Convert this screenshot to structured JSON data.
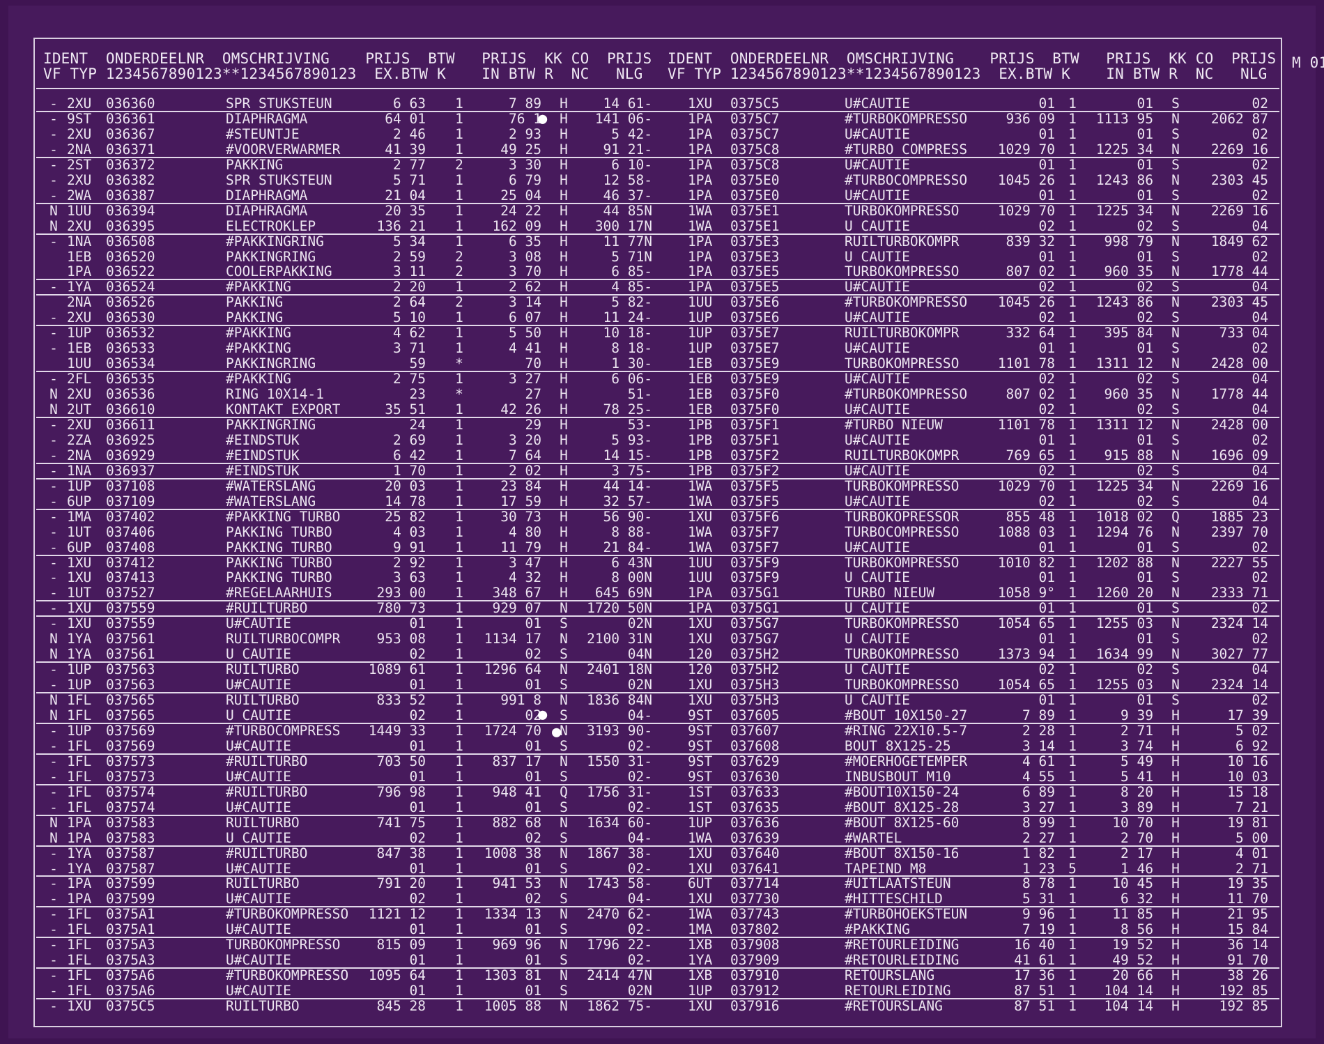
{
  "page_code": "M 01",
  "header": {
    "line1": "IDENT  ONDERDEELNR  OMSCHRIJVING    PRIJS  BTW   PRIJS  KK CO  PRIJS",
    "line2": "VF TYP 1234567890123**1234567890123  EX.BTW K    IN BTW R  NC   NLG"
  },
  "left_rows": [
    [
      "-",
      "2XU",
      "036360",
      "SPR STUKSTEUN",
      "6 63",
      "1",
      "7 89",
      "H",
      "14 61-"
    ],
    [
      "-",
      "9ST",
      "036361",
      "DIAPHRAGMA",
      "64 01",
      "1",
      "76 1",
      "H",
      "141 06-"
    ],
    [
      "-",
      "2XU",
      "036367",
      "#STEUNTJE",
      "2 46",
      "1",
      "2 93",
      "H",
      "5 42-"
    ],
    [
      "-",
      "2NA",
      "036371",
      "#VOORVERWARMER",
      "41 39",
      "1",
      "49 25",
      "H",
      "91 21-"
    ],
    [
      "-",
      "2ST",
      "036372",
      "PAKKING",
      "2 77",
      "2",
      "3 30",
      "H",
      "6 10-"
    ],
    [
      "-",
      "2XU",
      "036382",
      "SPR STUKSTEUN",
      "5 71",
      "1",
      "6 79",
      "H",
      "12 58-"
    ],
    [
      "-",
      "2WA",
      "036387",
      "DIAPHRAGMA",
      "21 04",
      "1",
      "25 04",
      "H",
      "46 37-"
    ],
    [
      "N",
      "1UU",
      "036394",
      "DIAPHRAGMA",
      "20 35",
      "1",
      "24 22",
      "H",
      "44 85N"
    ],
    [
      "N",
      "2XU",
      "036395",
      "ELECTROKLEP",
      "136 21",
      "1",
      "162 09",
      "H",
      "300 17N"
    ],
    [
      "-",
      "1NA",
      "036508",
      "#PAKKINGRING",
      "5 34",
      "1",
      "6 35",
      "H",
      "11 77N"
    ],
    [
      "",
      "1EB",
      "036520",
      "PAKKINGRING",
      "2 59",
      "2",
      "3 08",
      "H",
      "5 71N"
    ],
    [
      "",
      "1PA",
      "036522",
      "COOLERPAKKING",
      "3 11",
      "2",
      "3 70",
      "H",
      "6 85-"
    ],
    [
      "-",
      "1YA",
      "036524",
      "#PAKKING",
      "2 20",
      "1",
      "2 62",
      "H",
      "4 85-"
    ],
    [
      "",
      "2NA",
      "036526",
      "PAKKING",
      "2 64",
      "2",
      "3 14",
      "H",
      "5 82-"
    ],
    [
      "-",
      "2XU",
      "036530",
      "PAKKING",
      "5 10",
      "1",
      "6 07",
      "H",
      "11 24-"
    ],
    [
      "-",
      "1UP",
      "036532",
      "#PAKKING",
      "4 62",
      "1",
      "5 50",
      "H",
      "10 18-"
    ],
    [
      "-",
      "1EB",
      "036533",
      "#PAKKING",
      "3 71",
      "1",
      "4 41",
      "H",
      "8 18-"
    ],
    [
      "",
      "1UU",
      "036534",
      "PAKKINGRING",
      "59",
      "*",
      "70",
      "H",
      "1 30-"
    ],
    [
      "-",
      "2FL",
      "036535",
      "#PAKKING",
      "2 75",
      "1",
      "3 27",
      "H",
      "6 06-"
    ],
    [
      "N",
      "2XU",
      "036536",
      "RING 10X14-1",
      "23",
      "*",
      "27",
      "H",
      "51-"
    ],
    [
      "N",
      "2UT",
      "036610",
      "KONTAKT EXPORT",
      "35 51",
      "1",
      "42 26",
      "H",
      "78 25-"
    ],
    [
      "-",
      "2XU",
      "036611",
      "PAKKINGRING",
      "24",
      "1",
      "29",
      "H",
      "53-"
    ],
    [
      "-",
      "2ZA",
      "036925",
      "#EINDSTUK",
      "2 69",
      "1",
      "3 20",
      "H",
      "5 93-"
    ],
    [
      "-",
      "2NA",
      "036929",
      "#EINDSTUK",
      "6 42",
      "1",
      "7 64",
      "H",
      "14 15-"
    ],
    [
      "-",
      "1NA",
      "036937",
      "#EINDSTUK",
      "1 70",
      "1",
      "2 02",
      "H",
      "3 75-"
    ],
    [
      "-",
      "1UP",
      "037108",
      "#WATERSLANG",
      "20 03",
      "1",
      "23 84",
      "H",
      "44 14-"
    ],
    [
      "-",
      "6UP",
      "037109",
      "#WATERSLANG",
      "14 78",
      "1",
      "17 59",
      "H",
      "32 57-"
    ],
    [
      "-",
      "1MA",
      "037402",
      "#PAKKING TURBO",
      "25 82",
      "1",
      "30 73",
      "H",
      "56 90-"
    ],
    [
      "-",
      "1UT",
      "037406",
      "PAKKING TURBO",
      "4 03",
      "1",
      "4 80",
      "H",
      "8 88-"
    ],
    [
      "-",
      "6UP",
      "037408",
      "PAKKING TURBO",
      "9 91",
      "1",
      "11 79",
      "H",
      "21 84-"
    ],
    [
      "-",
      "1XU",
      "037412",
      "PAKKING TURBO",
      "2 92",
      "1",
      "3 47",
      "H",
      "6 43N"
    ],
    [
      "-",
      "1XU",
      "037413",
      "PAKKING TURBO",
      "3 63",
      "1",
      "4 32",
      "H",
      "8 00N"
    ],
    [
      "-",
      "1UT",
      "037527",
      "#REGELAARHUIS",
      "293 00",
      "1",
      "348 67",
      "H",
      "645 69N"
    ],
    [
      "-",
      "1XU",
      "037559",
      "#RUILTURBO",
      "780 73",
      "1",
      "929 07",
      "N",
      "1720 50N"
    ],
    [
      "-",
      "1XU",
      "037559",
      "U#CAUTIE",
      "01",
      "1",
      "01",
      "S",
      "02N"
    ],
    [
      "N",
      "1YA",
      "037561",
      "RUILTURBOCOMPR",
      "953 08",
      "1",
      "1134 17",
      "N",
      "2100 31N"
    ],
    [
      "N",
      "1YA",
      "037561",
      "U CAUTIE",
      "02",
      "1",
      "02",
      "S",
      "04N"
    ],
    [
      "-",
      "1UP",
      "037563",
      "RUILTURBO",
      "1089 61",
      "1",
      "1296 64",
      "N",
      "2401 18N"
    ],
    [
      "-",
      "1UP",
      "037563",
      "U#CAUTIE",
      "01",
      "1",
      "01",
      "S",
      "02N"
    ],
    [
      "N",
      "1FL",
      "037565",
      "RUILTURBO",
      "833 52",
      "1",
      "991 8",
      "N",
      "1836 84N"
    ],
    [
      "N",
      "1FL",
      "037565",
      "U CAUTIE",
      "02",
      "1",
      "02",
      "S",
      "04-"
    ],
    [
      "-",
      "1UP",
      "037569",
      "#TURBOCOMPRESS",
      "1449 33",
      "1",
      "1724 70",
      "N",
      "3193 90-"
    ],
    [
      "-",
      "1FL",
      "037569",
      "U#CAUTIE",
      "01",
      "1",
      "01",
      "S",
      "02-"
    ],
    [
      "-",
      "1FL",
      "037573",
      "#RUILTURBO",
      "703 50",
      "1",
      "837 17",
      "N",
      "1550 31-"
    ],
    [
      "-",
      "1FL",
      "037573",
      "U#CAUTIE",
      "01",
      "1",
      "01",
      "S",
      "02-"
    ],
    [
      "-",
      "1FL",
      "037574",
      "#RUILTURBO",
      "796 98",
      "1",
      "948 41",
      "Q",
      "1756 31-"
    ],
    [
      "-",
      "1FL",
      "037574",
      "U#CAUTIE",
      "01",
      "1",
      "01",
      "S",
      "02-"
    ],
    [
      "N",
      "1PA",
      "037583",
      "RUILTURBO",
      "741 75",
      "1",
      "882 68",
      "N",
      "1634 60-"
    ],
    [
      "N",
      "1PA",
      "037583",
      "U CAUTIE",
      "02",
      "1",
      "02",
      "S",
      "04-"
    ],
    [
      "-",
      "1YA",
      "037587",
      "#RUILTURBO",
      "847 38",
      "1",
      "1008 38",
      "N",
      "1867 38-"
    ],
    [
      "-",
      "1YA",
      "037587",
      "U#CAUTIE",
      "01",
      "1",
      "01",
      "S",
      "02-"
    ],
    [
      "-",
      "1PA",
      "037599",
      "RUILTURBO",
      "791 20",
      "1",
      "941 53",
      "N",
      "1743 58-"
    ],
    [
      "-",
      "1PA",
      "037599",
      "U#CAUTIE",
      "02",
      "1",
      "02",
      "S",
      "04-"
    ],
    [
      "-",
      "1FL",
      "0375A1",
      "#TURBOKOMPRESSO",
      "1121 12",
      "1",
      "1334 13",
      "N",
      "2470 62-"
    ],
    [
      "-",
      "1FL",
      "0375A1",
      "U#CAUTIE",
      "01",
      "1",
      "01",
      "S",
      "02-"
    ],
    [
      "-",
      "1FL",
      "0375A3",
      "TURBOKOMPRESSO",
      "815 09",
      "1",
      "969 96",
      "N",
      "1796 22-"
    ],
    [
      "-",
      "1FL",
      "0375A3",
      "U#CAUTIE",
      "01",
      "1",
      "01",
      "S",
      "02-"
    ],
    [
      "-",
      "1FL",
      "0375A6",
      "#TURBOKOMPRESSO",
      "1095 64",
      "1",
      "1303 81",
      "N",
      "2414 47N"
    ],
    [
      "-",
      "1FL",
      "0375A6",
      "U#CAUTIE",
      "01",
      "1",
      "01",
      "S",
      "02N"
    ],
    [
      "-",
      "1XU",
      "0375C5",
      "RUILTURBO",
      "845 28",
      "1",
      "1005 88",
      "N",
      "1862 75-"
    ]
  ],
  "right_rows": [
    [
      "1XU",
      "0375C5",
      "U#CAUTIE",
      "01",
      "1",
      "01",
      "S",
      "02"
    ],
    [
      "1PA",
      "0375C7",
      "#TURBOKOMPRESSO",
      "936 09",
      "1",
      "1113 95",
      "N",
      "2062 87"
    ],
    [
      "1PA",
      "0375C7",
      "U#CAUTIE",
      "01",
      "1",
      "01",
      "S",
      "02"
    ],
    [
      "1PA",
      "0375C8",
      "#TURBO COMPRESS",
      "1029 70",
      "1",
      "1225 34",
      "N",
      "2269 16"
    ],
    [
      "1PA",
      "0375C8",
      "U#CAUTIE",
      "01",
      "1",
      "01",
      "S",
      "02"
    ],
    [
      "1PA",
      "0375E0",
      "#TURBOCOMPRESSO",
      "1045 26",
      "1",
      "1243 86",
      "N",
      "2303 45"
    ],
    [
      "1PA",
      "0375E0",
      "U#CAUTIE",
      "01",
      "1",
      "01",
      "S",
      "02"
    ],
    [
      "1WA",
      "0375E1",
      "TURBOKOMPRESSO",
      "1029 70",
      "1",
      "1225 34",
      "N",
      "2269 16"
    ],
    [
      "1WA",
      "0375E1",
      "U CAUTIE",
      "02",
      "1",
      "02",
      "S",
      "04"
    ],
    [
      "1PA",
      "0375E3",
      "RUILTURBOKOMPR",
      "839 32",
      "1",
      "998 79",
      "N",
      "1849 62"
    ],
    [
      "1PA",
      "0375E3",
      "U CAUTIE",
      "01",
      "1",
      "01",
      "S",
      "02"
    ],
    [
      "1PA",
      "0375E5",
      "TURBOKOMPRESSO",
      "807 02",
      "1",
      "960 35",
      "N",
      "1778 44"
    ],
    [
      "1PA",
      "0375E5",
      "U#CAUTIE",
      "02",
      "1",
      "02",
      "S",
      "04"
    ],
    [
      "1UU",
      "0375E6",
      "#TURBOKOMPRESSO",
      "1045 26",
      "1",
      "1243 86",
      "N",
      "2303 45"
    ],
    [
      "1UP",
      "0375E6",
      "U#CAUTIE",
      "02",
      "1",
      "02",
      "S",
      "04"
    ],
    [
      "1UP",
      "0375E7",
      "RUILTURBOKOMPR",
      "332 64",
      "1",
      "395 84",
      "N",
      "733 04"
    ],
    [
      "1UP",
      "0375E7",
      "U#CAUTIE",
      "01",
      "1",
      "01",
      "S",
      "02"
    ],
    [
      "1EB",
      "0375E9",
      "TURBOKOMPRESSO",
      "1101 78",
      "1",
      "1311 12",
      "N",
      "2428 00"
    ],
    [
      "1EB",
      "0375E9",
      "U#CAUTIE",
      "02",
      "1",
      "02",
      "S",
      "04"
    ],
    [
      "1EB",
      "0375F0",
      "#TURBOKOMPRESSO",
      "807 02",
      "1",
      "960 35",
      "N",
      "1778 44"
    ],
    [
      "1EB",
      "0375F0",
      "U#CAUTIE",
      "02",
      "1",
      "02",
      "S",
      "04"
    ],
    [
      "1PB",
      "0375F1",
      "#TURBO NIEUW",
      "1101 78",
      "1",
      "1311 12",
      "N",
      "2428 00"
    ],
    [
      "1PB",
      "0375F1",
      "U#CAUTIE",
      "01",
      "1",
      "01",
      "S",
      "02"
    ],
    [
      "1PB",
      "0375F2",
      "RUILTURBOKOMPR",
      "769 65",
      "1",
      "915 88",
      "N",
      "1696 09"
    ],
    [
      "1PB",
      "0375F2",
      "U#CAUTIE",
      "02",
      "1",
      "02",
      "S",
      "04"
    ],
    [
      "1WA",
      "0375F5",
      "TURBOKOMPRESSO",
      "1029 70",
      "1",
      "1225 34",
      "N",
      "2269 16"
    ],
    [
      "1WA",
      "0375F5",
      "U#CAUTIE",
      "02",
      "1",
      "02",
      "S",
      "04"
    ],
    [
      "1XU",
      "0375F6",
      "TURBOKOPRESSOR",
      "855 48",
      "1",
      "1018 02",
      "Q",
      "1885 23"
    ],
    [
      "1WA",
      "0375F7",
      "TURBOCOMPRESSO",
      "1088 03",
      "1",
      "1294 76",
      "N",
      "2397 70"
    ],
    [
      "1WA",
      "0375F7",
      "U#CAUTIE",
      "01",
      "1",
      "01",
      "S",
      "02"
    ],
    [
      "1UU",
      "0375F9",
      "TURBOKOMPRESSO",
      "1010 82",
      "1",
      "1202 88",
      "N",
      "2227 55"
    ],
    [
      "1UU",
      "0375F9",
      "U CAUTIE",
      "01",
      "1",
      "01",
      "S",
      "02"
    ],
    [
      "1PA",
      "0375G1",
      "TURBO NIEUW",
      "1058 9°",
      "1",
      "1260 20",
      "N",
      "2333 71"
    ],
    [
      "1PA",
      "0375G1",
      "U CAUTIE",
      "01",
      "1",
      "01",
      "S",
      "02"
    ],
    [
      "1XU",
      "0375G7",
      "TURBOKOMPRESSO",
      "1054 65",
      "1",
      "1255 03",
      "N",
      "2324 14"
    ],
    [
      "1XU",
      "0375G7",
      "U CAUTIE",
      "01",
      "1",
      "01",
      "S",
      "02"
    ],
    [
      "120",
      "0375H2",
      "TURBOKOMPRESSO",
      "1373 94",
      "1",
      "1634 99",
      "N",
      "3027 77"
    ],
    [
      "120",
      "0375H2",
      "U CAUTIE",
      "02",
      "1",
      "02",
      "S",
      "04"
    ],
    [
      "1XU",
      "0375H3",
      "TURBOKOMPRESSO",
      "1054 65",
      "1",
      "1255 03",
      "N",
      "2324 14"
    ],
    [
      "1XU",
      "0375H3",
      "U CAUTIE",
      "01",
      "1",
      "01",
      "S",
      "02"
    ],
    [
      "9ST",
      "037605",
      "#BOUT 10X150-27",
      "7 89",
      "1",
      "9 39",
      "H",
      "17 39"
    ],
    [
      "9ST",
      "037607",
      "#RING 22X10.5-7",
      "2 28",
      "1",
      "2 71",
      "H",
      "5 02"
    ],
    [
      "9ST",
      "037608",
      "BOUT 8X125-25",
      "3 14",
      "1",
      "3 74",
      "H",
      "6 92"
    ],
    [
      "9ST",
      "037629",
      "#MOERHOGETEMPER",
      "4 61",
      "1",
      "5 49",
      "H",
      "10 16"
    ],
    [
      "9ST",
      "037630",
      "INBUSBOUT M10",
      "4 55",
      "1",
      "5 41",
      "H",
      "10 03"
    ],
    [
      "1ST",
      "037633",
      "#BOUT10X150-24",
      "6 89",
      "1",
      "8 20",
      "H",
      "15 18"
    ],
    [
      "1ST",
      "037635",
      "#BOUT 8X125-28",
      "3 27",
      "1",
      "3 89",
      "H",
      "7 21"
    ],
    [
      "1UP",
      "037636",
      "#BOUT 8X125-60",
      "8 99",
      "1",
      "10 70",
      "H",
      "19 81"
    ],
    [
      "1WA",
      "037639",
      "#WARTEL",
      "2 27",
      "1",
      "2 70",
      "H",
      "5 00"
    ],
    [
      "1XU",
      "037640",
      "#BOUT 8X150-16",
      "1 82",
      "1",
      "2 17",
      "H",
      "4 01"
    ],
    [
      "1XU",
      "037641",
      "TAPEIND M8",
      "1 23",
      "5",
      "1 46",
      "H",
      "2 71"
    ],
    [
      "6UT",
      "037714",
      "#UITLAATSTEUN",
      "8 78",
      "1",
      "10 45",
      "H",
      "19 35"
    ],
    [
      "1XU",
      "037730",
      "#HITTESCHILD",
      "5 31",
      "1",
      "6 32",
      "H",
      "11 70"
    ],
    [
      "1WA",
      "037743",
      "#TURBOHOEKSTEUN",
      "9 96",
      "1",
      "11 85",
      "H",
      "21 95"
    ],
    [
      "1MA",
      "037802",
      "#PAKKING",
      "7 19",
      "1",
      "8 56",
      "H",
      "15 84"
    ],
    [
      "1XB",
      "037908",
      "#RETOURLEIDING",
      "16 40",
      "1",
      "19 52",
      "H",
      "36 14"
    ],
    [
      "1YA",
      "037909",
      "#RETOURLEIDING",
      "41 61",
      "1",
      "49 52",
      "H",
      "91 70"
    ],
    [
      "1XB",
      "037910",
      "RETOURSLANG",
      "17 36",
      "1",
      "20 66",
      "H",
      "38 26"
    ],
    [
      "1UP",
      "037912",
      "RETOURLEIDING",
      "87 51",
      "1",
      "104 14",
      "H",
      "192 85"
    ],
    [
      "1XU",
      "037916",
      "#RETOURSLANG",
      "87 51",
      "1",
      "104 14",
      "H",
      "192 85"
    ]
  ],
  "rule_after_rows": [
    0,
    3,
    6,
    8,
    11,
    12,
    14,
    17,
    20,
    23,
    24,
    26,
    29,
    32,
    33,
    36,
    38,
    40,
    42,
    44,
    46,
    48,
    50,
    52,
    54,
    56,
    58
  ]
}
